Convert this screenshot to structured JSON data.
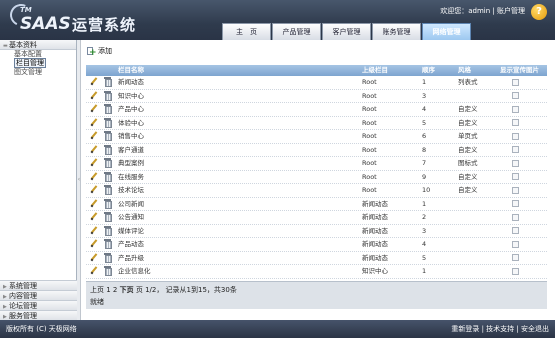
{
  "header": {
    "logo_tm": "TM",
    "logo_saas": "SAAS",
    "logo_cn": "运营系统",
    "greeting": "欢迎您：admin",
    "separator": "|",
    "account_link": "账户管理",
    "help_label": "?"
  },
  "nav": {
    "tabs": [
      {
        "label": "主　页",
        "active": false
      },
      {
        "label": "产品管理",
        "active": false
      },
      {
        "label": "客户管理",
        "active": false
      },
      {
        "label": "账务管理",
        "active": false
      },
      {
        "label": "网络管理",
        "active": true
      }
    ]
  },
  "sidebar": {
    "top_group": {
      "label": "基本资料",
      "expanded": true
    },
    "items": [
      {
        "label": "基本配置",
        "selected": false
      },
      {
        "label": "栏目管理",
        "selected": true
      },
      {
        "label": "图文管理",
        "selected": false
      }
    ],
    "bottom_groups": [
      {
        "label": "系统管理"
      },
      {
        "label": "内容管理"
      },
      {
        "label": "论坛管理"
      },
      {
        "label": "服务管理"
      }
    ]
  },
  "toolbar": {
    "add_label": "添加"
  },
  "grid": {
    "headers": {
      "name": "栏目名称",
      "parent": "上级栏目",
      "order": "顺序",
      "style": "风格",
      "show": "显示宣传图片"
    },
    "rows": [
      {
        "name": "新闻动态",
        "parent": "Root",
        "order": "1",
        "style": "列表式"
      },
      {
        "name": "知识中心",
        "parent": "Root",
        "order": "3",
        "style": ""
      },
      {
        "name": "产品中心",
        "parent": "Root",
        "order": "4",
        "style": "自定义"
      },
      {
        "name": "体验中心",
        "parent": "Root",
        "order": "5",
        "style": "自定义"
      },
      {
        "name": "销售中心",
        "parent": "Root",
        "order": "6",
        "style": "单页式"
      },
      {
        "name": "客户通道",
        "parent": "Root",
        "order": "8",
        "style": "自定义"
      },
      {
        "name": "典型案例",
        "parent": "Root",
        "order": "7",
        "style": "图标式"
      },
      {
        "name": "在线服务",
        "parent": "Root",
        "order": "9",
        "style": "自定义"
      },
      {
        "name": "技术论坛",
        "parent": "Root",
        "order": "10",
        "style": "自定义"
      },
      {
        "name": "公司新闻",
        "parent": "新闻动态",
        "order": "1",
        "style": ""
      },
      {
        "name": "公告通知",
        "parent": "新闻动态",
        "order": "2",
        "style": ""
      },
      {
        "name": "媒体评论",
        "parent": "新闻动态",
        "order": "3",
        "style": ""
      },
      {
        "name": "产品动态",
        "parent": "新闻动态",
        "order": "4",
        "style": ""
      },
      {
        "name": "产品升级",
        "parent": "新闻动态",
        "order": "5",
        "style": ""
      },
      {
        "name": "企业信息化",
        "parent": "知识中心",
        "order": "1",
        "style": ""
      }
    ]
  },
  "pager": {
    "prev": "上页",
    "pages": "1 2",
    "next": "下页",
    "info": "页 1/2， 记录从1到15，共30条",
    "status": "就绪"
  },
  "footer": {
    "copyright": "版权所有 (C) 天极网络",
    "relogin": "重新登录",
    "support": "技术支持",
    "logout": "安全退出",
    "sep": "|"
  },
  "colors": {
    "header_bg": "#2f3b4d",
    "grid_header": "#8eb2da",
    "active_tab": "#9dc8f0"
  }
}
